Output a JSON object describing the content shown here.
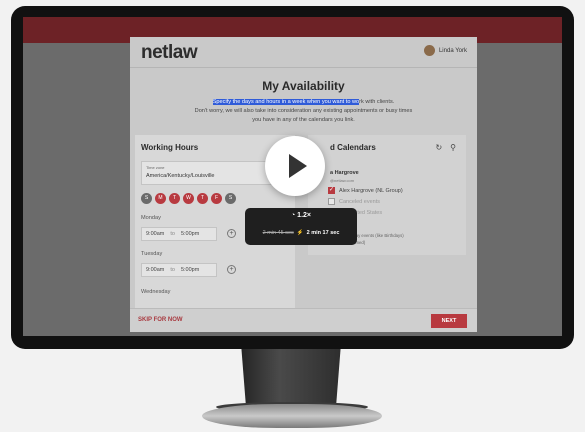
{
  "app": {
    "logo": "netlaw",
    "user_name": "Linda York",
    "title": "My Availability",
    "subtitle_highlight": "Specify the days and hours in a week when you want to wo",
    "subtitle_rest": "rk with clients.",
    "subtitle_line2": "Don't worry, we will also take into consideration any existing appointments or busy times",
    "subtitle_line3": "you have in any of the calendars you link."
  },
  "working_hours": {
    "title": "Working Hours",
    "timezone_label": "Time zone",
    "timezone_value": "America/Kentucky/Louisville",
    "days": [
      "S",
      "M",
      "T",
      "W",
      "T",
      "F",
      "S"
    ],
    "days_active": [
      false,
      true,
      true,
      true,
      true,
      true,
      false
    ],
    "schedule": [
      {
        "day": "Monday",
        "start": "9:00am",
        "to": "to",
        "end": "5:00pm"
      },
      {
        "day": "Tuesday",
        "start": "9:00am",
        "to": "to",
        "end": "5:00pm"
      },
      {
        "day": "Wednesday"
      }
    ]
  },
  "calendars": {
    "title": "d Calendars",
    "account_name": "a Hargrove",
    "account_email": "@netlaw.com",
    "items": [
      {
        "label": "Alex Hargrove (NL Group)",
        "checked": true
      },
      {
        "label": "Canceled events",
        "checked": false
      },
      {
        "label": "s in United States",
        "checked": false
      }
    ],
    "note_line1": "with mark all-day events (like Birthdays)",
    "note_line2": "omatically deemed)"
  },
  "footer": {
    "skip": "SKIP FOR NOW",
    "next": "NEXT"
  },
  "video": {
    "speed": "1.2×",
    "old_time": "2 min 45 sec",
    "new_time": "2 min 17 sec"
  },
  "colors": {
    "accent": "#b83a40",
    "topbar": "#6d2226"
  }
}
